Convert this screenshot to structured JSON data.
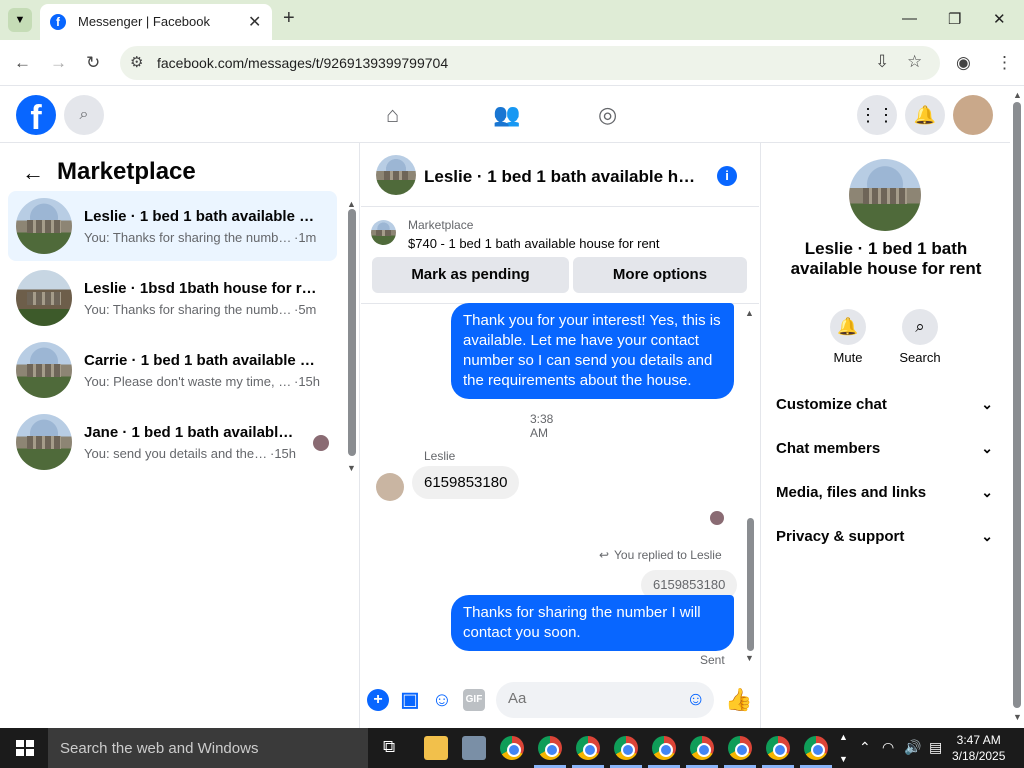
{
  "browser": {
    "tab_title": "Messenger | Facebook",
    "url": "facebook.com/messages/t/9269139399799704"
  },
  "sidebar": {
    "title": "Marketplace",
    "conversations": [
      {
        "name": "Leslie · 1 bed 1 bath available ho...",
        "preview": "You: Thanks for sharing the numbe...",
        "time": "·1m",
        "active": true
      },
      {
        "name": "Leslie · 1bsd 1bath house for ren...",
        "preview": "You: Thanks for sharing the numbe...",
        "time": "·5m",
        "active": false
      },
      {
        "name": "Carrie · 1 bed 1 bath available ho...",
        "preview": "You: Please don't waste my time, if...",
        "time": "·15h",
        "active": false
      },
      {
        "name": "Jane · 1 bed 1 bath available h...",
        "preview": "You: send you details and the r...",
        "time": "·15h",
        "active": false
      }
    ]
  },
  "chat": {
    "title": "Leslie · 1 bed 1 bath available hou...",
    "listing": {
      "category": "Marketplace",
      "price_title": "$740 - 1 bed 1 bath available house for rent",
      "mark_pending": "Mark as pending",
      "more_options": "More options"
    },
    "messages": {
      "out1": "Thank you for your interest! Yes, this is available. Let me have your contact number so I can send you details and the requirements about the house.",
      "timestamp": "3:38 AM",
      "sender": "Leslie",
      "in1": "6159853180",
      "reply_label": "You replied to Leslie",
      "quoted": "6159853180",
      "out2": "Thanks for sharing the number I will contact you soon.",
      "status": "Sent"
    },
    "composer_placeholder": "Aa"
  },
  "details": {
    "name": "Leslie · 1 bed 1 bath available house for rent",
    "mute_label": "Mute",
    "search_label": "Search",
    "sections": [
      "Customize chat",
      "Chat members",
      "Media, files and links",
      "Privacy & support"
    ]
  },
  "taskbar": {
    "search_placeholder": "Search the web and Windows",
    "time": "3:47 AM",
    "date": "3/18/2025"
  },
  "colors": {
    "accent": "#0866ff",
    "chrome_bg": "#dfecd6",
    "active_conv": "#ebf5ff"
  }
}
